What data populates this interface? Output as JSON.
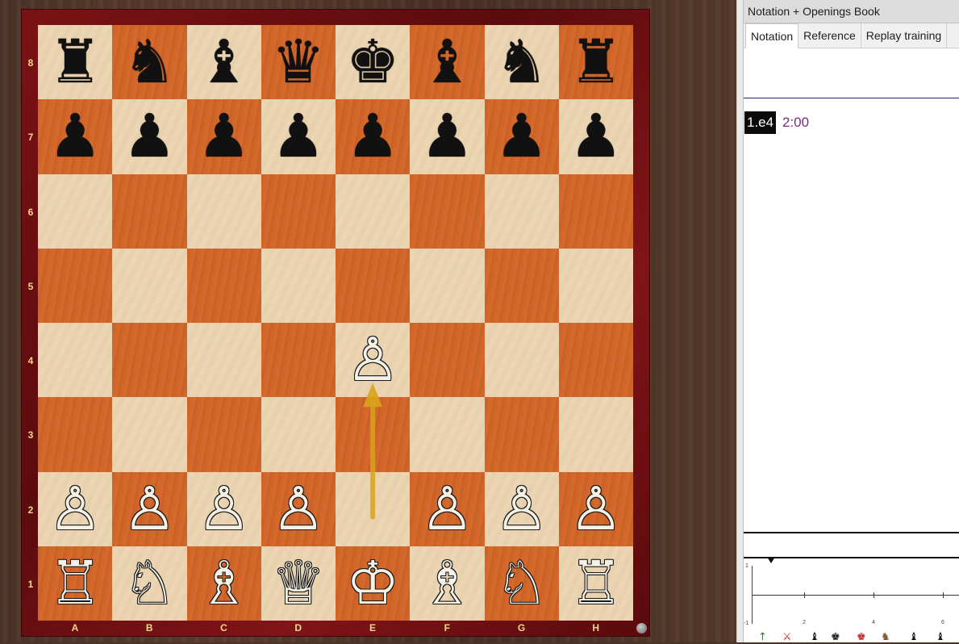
{
  "board": {
    "ranks": [
      "8",
      "7",
      "6",
      "5",
      "4",
      "3",
      "2",
      "1"
    ],
    "files": [
      "A",
      "B",
      "C",
      "D",
      "E",
      "F",
      "G",
      "H"
    ],
    "position": [
      [
        "♜",
        "♞",
        "♝",
        "♛",
        "♚",
        "♝",
        "♞",
        "♜"
      ],
      [
        "♟",
        "♟",
        "♟",
        "♟",
        "♟",
        "♟",
        "♟",
        "♟"
      ],
      [
        "",
        "",
        "",
        "",
        "",
        "",
        "",
        ""
      ],
      [
        "",
        "",
        "",
        "",
        "",
        "",
        "",
        ""
      ],
      [
        "",
        "",
        "",
        "",
        "♙",
        "",
        "",
        ""
      ],
      [
        "",
        "",
        "",
        "",
        "",
        "",
        "",
        ""
      ],
      [
        "♙",
        "♙",
        "♙",
        "♙",
        "",
        "♙",
        "♙",
        "♙"
      ],
      [
        "♖",
        "♘",
        "♗",
        "♕",
        "♔",
        "♗",
        "♘",
        "♖"
      ]
    ],
    "last_move": {
      "from": "e2",
      "to": "e4",
      "arrow_color": "#d9a31a"
    },
    "light_color": "#ecd6b4",
    "dark_color": "#d2662a",
    "frame_color": "#7a1215"
  },
  "panel": {
    "title": "Notation + Openings Book",
    "tabs": [
      {
        "label": "Notation",
        "active": true
      },
      {
        "label": "Reference",
        "active": false
      },
      {
        "label": "Replay training",
        "active": false
      }
    ],
    "moves": [
      {
        "text": "1.e4",
        "time": "2:00"
      }
    ]
  },
  "graph": {
    "y_labels": [
      "1",
      "-1"
    ],
    "x_labels": [
      "2",
      "4",
      "6"
    ],
    "icons": [
      "up-arrow-icon",
      "cross-swords-icon",
      "piece-icon",
      "piece-icon",
      "piece-icon",
      "piece-icon",
      "piece-icon",
      "piece-icon"
    ]
  }
}
